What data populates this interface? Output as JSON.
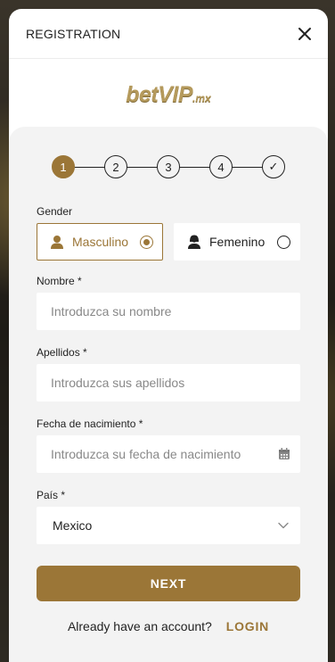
{
  "modal": {
    "title": "REGISTRATION"
  },
  "logo": {
    "text": "betVIP",
    "suffix": ".mx"
  },
  "stepper": {
    "steps": [
      "1",
      "2",
      "3",
      "4",
      "✓"
    ],
    "active_step": 1
  },
  "gender": {
    "label": "Gender",
    "options": [
      {
        "label": "Masculino",
        "selected": true
      },
      {
        "label": "Femenino",
        "selected": false
      }
    ]
  },
  "fields": {
    "nombre": {
      "label": "Nombre *",
      "placeholder": "Introduzca su nombre",
      "value": ""
    },
    "apellidos": {
      "label": "Apellidos *",
      "placeholder": "Introduzca sus apellidos",
      "value": ""
    },
    "fecha": {
      "label": "Fecha de nacimiento *",
      "placeholder": "Introduzca su fecha de nacimiento",
      "value": ""
    },
    "pais": {
      "label": "País *",
      "value": "Mexico"
    }
  },
  "actions": {
    "next_label": "NEXT",
    "login_prompt": "Already have an account?",
    "login_label": "LOGIN"
  },
  "colors": {
    "accent": "#9b7637",
    "card_bg": "#f3f3f3",
    "text": "#222222"
  },
  "icons": {
    "close": "close-icon",
    "male": "male-avatar-icon",
    "female": "female-avatar-icon",
    "calendar": "calendar-icon",
    "chevron": "chevron-down-icon"
  }
}
